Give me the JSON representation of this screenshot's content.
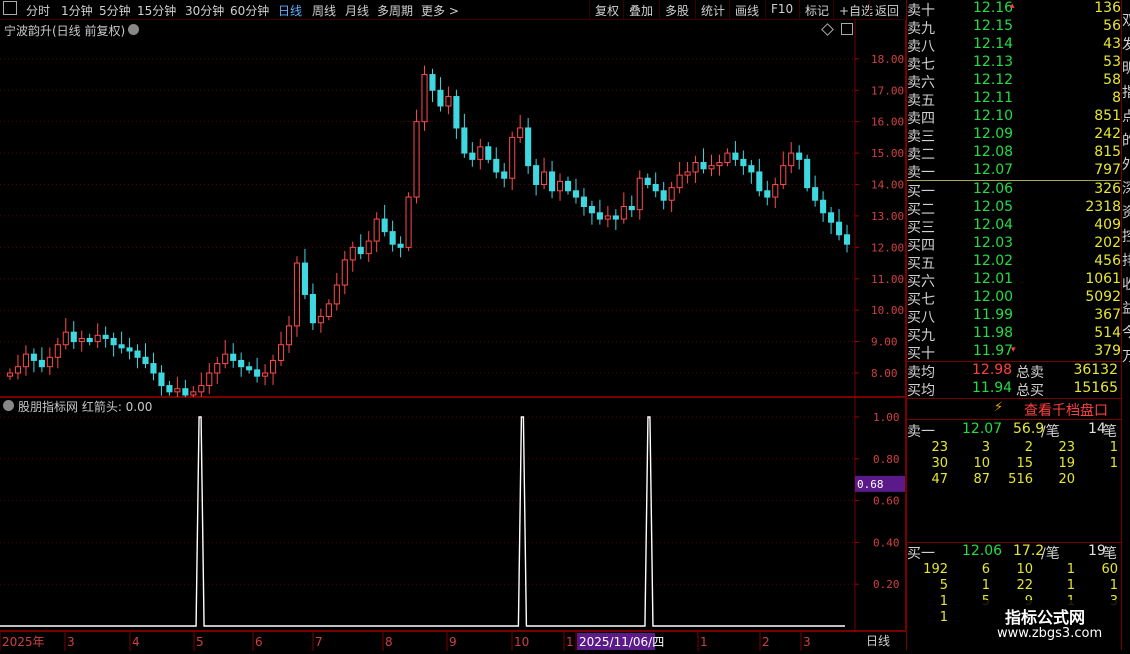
{
  "toolbar": {
    "periods": [
      "分时",
      "1分钟",
      "5分钟",
      "15分钟",
      "30分钟",
      "60分钟",
      "日线",
      "周线",
      "月线",
      "多周期",
      "更多 >"
    ],
    "active_index": 6,
    "actions": [
      "复权",
      "叠加",
      "多股",
      "统计",
      "画线",
      "F10",
      "标记",
      "+自选",
      "返回"
    ]
  },
  "main_chart": {
    "title": "宁波韵升(日线 前复权)",
    "chart_data": {
      "type": "candlestick",
      "y_ticks": [
        "18.00",
        "17.00",
        "16.00",
        "15.00",
        "14.00",
        "13.00",
        "12.00",
        "11.00",
        "10.00",
        "9.00",
        "8.00"
      ],
      "ylim": [
        7.3,
        18.6
      ],
      "x_ticks": [
        "2025年",
        "3",
        "4",
        "5",
        "6",
        "7",
        "8",
        "9",
        "10",
        "1",
        "2025/11/06/四",
        "1",
        "2",
        "3"
      ],
      "up_color": "#ff4a4a",
      "down_color": "#3fd8e0",
      "closes": [
        8.0,
        8.2,
        8.6,
        8.4,
        8.2,
        8.5,
        8.9,
        9.3,
        9.0,
        9.1,
        9.0,
        9.2,
        9.1,
        8.9,
        8.8,
        8.7,
        8.5,
        8.3,
        8.0,
        7.6,
        7.4,
        7.5,
        7.3,
        7.4,
        7.6,
        8.0,
        8.3,
        8.6,
        8.4,
        8.2,
        8.1,
        7.9,
        8.0,
        8.4,
        8.9,
        9.5,
        11.5,
        10.5,
        9.6,
        9.8,
        10.2,
        10.8,
        11.6,
        12.0,
        11.8,
        12.2,
        12.9,
        12.5,
        12.1,
        12.0,
        13.6,
        16.0,
        17.5,
        17.0,
        16.5,
        16.8,
        15.8,
        15.0,
        14.8,
        15.2,
        14.8,
        14.4,
        14.2,
        15.5,
        15.8,
        14.6,
        14.0,
        14.4,
        13.8,
        14.1,
        13.8,
        13.6,
        13.3,
        13.1,
        12.9,
        13.0,
        12.9,
        13.3,
        13.2,
        14.2,
        14.0,
        13.8,
        13.5,
        13.9,
        14.3,
        14.4,
        14.7,
        14.5,
        14.6,
        14.7,
        15.0,
        14.8,
        14.6,
        14.4,
        13.8,
        13.6,
        14.0,
        14.6,
        15.0,
        14.8,
        13.9,
        13.5,
        13.1,
        12.8,
        12.4,
        12.1
      ]
    }
  },
  "indicator": {
    "title": "股朋指标网 红箭头: 0.00",
    "chart_data": {
      "type": "line",
      "name": "红箭头",
      "y_ticks": [
        "1.00",
        "0.80",
        "0.60",
        "0.40",
        "0.20"
      ],
      "ylim": [
        0,
        1.0
      ],
      "spike_positions": [
        0.234,
        0.611,
        0.759
      ],
      "current_value_label": "0.68"
    }
  },
  "bottom_bar": {
    "x_labels": [
      "2025年",
      "3",
      "4",
      "5",
      "6",
      "7",
      "8",
      "9",
      "10",
      "1",
      "2025/11/06/四",
      "1",
      "2",
      "3"
    ],
    "period_label": "日线"
  },
  "order_book": {
    "asks": [
      {
        "label": "卖十",
        "price": "12.16",
        "vol": "136"
      },
      {
        "label": "卖九",
        "price": "12.15",
        "vol": "56"
      },
      {
        "label": "卖八",
        "price": "12.14",
        "vol": "43"
      },
      {
        "label": "卖七",
        "price": "12.13",
        "vol": "53"
      },
      {
        "label": "卖六",
        "price": "12.12",
        "vol": "58"
      },
      {
        "label": "卖五",
        "price": "12.11",
        "vol": "8"
      },
      {
        "label": "卖四",
        "price": "12.10",
        "vol": "851"
      },
      {
        "label": "卖三",
        "price": "12.09",
        "vol": "242"
      },
      {
        "label": "卖二",
        "price": "12.08",
        "vol": "815"
      },
      {
        "label": "卖一",
        "price": "12.07",
        "vol": "797"
      }
    ],
    "bids": [
      {
        "label": "买一",
        "price": "12.06",
        "vol": "326"
      },
      {
        "label": "买二",
        "price": "12.05",
        "vol": "2318"
      },
      {
        "label": "买三",
        "price": "12.04",
        "vol": "409"
      },
      {
        "label": "买四",
        "price": "12.03",
        "vol": "202"
      },
      {
        "label": "买五",
        "price": "12.02",
        "vol": "456"
      },
      {
        "label": "买六",
        "price": "12.01",
        "vol": "1061"
      },
      {
        "label": "买七",
        "price": "12.00",
        "vol": "5092"
      },
      {
        "label": "买八",
        "price": "11.99",
        "vol": "367"
      },
      {
        "label": "买九",
        "price": "11.98",
        "vol": "514"
      },
      {
        "label": "买十",
        "price": "11.97",
        "vol": "379"
      }
    ],
    "sell_avg_label": "卖均",
    "sell_avg": "12.98",
    "total_sell_label": "总卖",
    "total_sell": "36132",
    "buy_avg_label": "买均",
    "buy_avg": "11.94",
    "total_buy_label": "总买",
    "total_buy": "15165",
    "thousand_link": "查看千档盘口",
    "ask1_detail": {
      "label": "卖一",
      "price": "12.07",
      "avg": "56.9",
      "unit": "/笔",
      "count": "14",
      "count_unit": "笔"
    },
    "ask1_queue": [
      [
        "23",
        "3",
        "2",
        "23",
        "1"
      ],
      [
        "30",
        "10",
        "15",
        "19",
        "1"
      ],
      [
        "47",
        "87",
        "516",
        "20",
        ""
      ]
    ],
    "bid1_detail": {
      "label": "买一",
      "price": "12.06",
      "avg": "17.2",
      "unit": "/笔",
      "count": "19",
      "count_unit": "笔"
    },
    "bid1_queue": [
      [
        "192",
        "6",
        "10",
        "1",
        "60"
      ],
      [
        "5",
        "1",
        "22",
        "1",
        "1"
      ],
      [
        "1",
        "5",
        "9",
        "1",
        "3"
      ],
      [
        "1",
        "",
        "",
        "",
        ""
      ]
    ]
  },
  "right_strip_chars": [
    "双",
    "发",
    "明",
    "指",
    "点",
    "的",
    "外",
    "深",
    "资",
    "控",
    "排",
    "收",
    "益",
    "今",
    "万"
  ],
  "watermark": {
    "line1": "指标公式网",
    "line2": "www.zbgs3.com"
  }
}
